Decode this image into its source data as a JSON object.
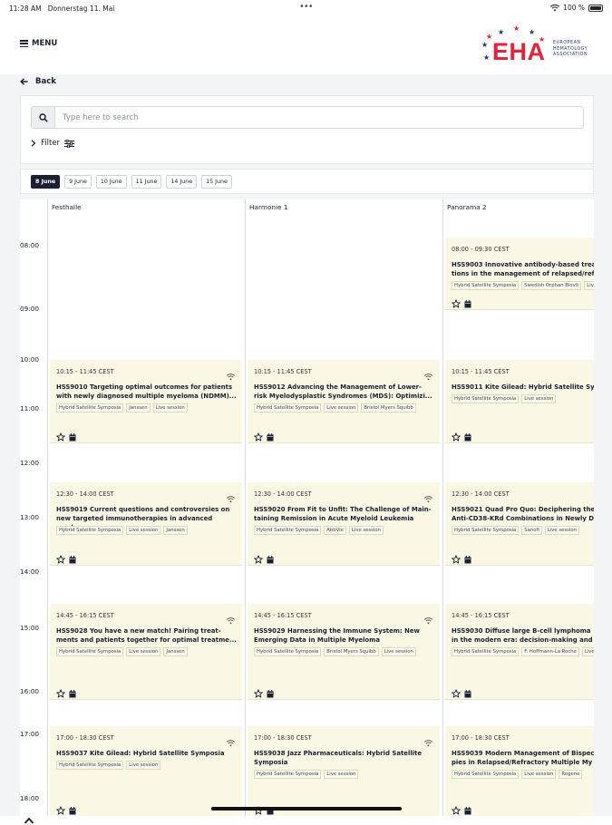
{
  "status": {
    "time": "11:28 AM",
    "date": "Donnerstag 11. Mai",
    "battery": "100 %"
  },
  "header": {
    "menu_label": "MENU",
    "logo_text": "EHA",
    "logo_sub": [
      "EUROPEAN",
      "HEMATOLOGY",
      "ASSOCIATION"
    ]
  },
  "back_label": "Back",
  "search": {
    "placeholder": "Type here to search"
  },
  "filter_label": "Filter",
  "dates": [
    "8 June",
    "9 June",
    "10 June",
    "11 June",
    "14 June",
    "15 June"
  ],
  "active_date": "8 June",
  "rooms": [
    "Festhalle",
    "Harmonie 1",
    "Panorama 2"
  ],
  "hours": [
    "08:00",
    "09:00",
    "10:00",
    "11:00",
    "12:00",
    "13:00",
    "14:00",
    "15:00",
    "16:00",
    "17:00",
    "18:00"
  ],
  "events": [
    {
      "room": 2,
      "slot": 0,
      "time": "08:00 - 09:30 CEST",
      "wifi": false,
      "title": "HSS9003 Innovative antibody-based trea\ntions in the management of relapsed/ref",
      "tags": [
        "Hybrid Satellite Symposia",
        "Swedish Orphan Biovit",
        "Live session"
      ]
    },
    {
      "room": 0,
      "slot": 1,
      "time": "10:15 - 11:45 CEST",
      "wifi": true,
      "title": "HSS9010 Targeting optimal outcomes for patients\nwith newly diagnosed multiple myeloma (NDMM)...",
      "tags": [
        "Hybrid Satellite Symposia",
        "Janssen",
        "Live session"
      ]
    },
    {
      "room": 1,
      "slot": 1,
      "time": "10:15 - 11:45 CEST",
      "wifi": true,
      "title": "HSS9012 Advancing the Management of Lower-\nrisk Myelodysplastic Syndromes (MDS): Optimizi...",
      "tags": [
        "Hybrid Satellite Symposia",
        "Live session",
        "Bristol Myers Squibb"
      ]
    },
    {
      "room": 2,
      "slot": 1,
      "time": "10:15 - 11:45 CEST",
      "wifi": false,
      "title": "HSS9011 Kite Gilead: Hybrid Satellite Sy",
      "tags": [
        "Hybrid Satellite Symposia",
        "Live session"
      ]
    },
    {
      "room": 0,
      "slot": 2,
      "time": "12:30 - 14:00 CEST",
      "wifi": true,
      "title": "HSS9019 Current questions and controversies on\nnew targeted immunotherapies in advanced myel...",
      "tags": [
        "Hybrid Satellite Symposia",
        "Live session",
        "Janssen"
      ]
    },
    {
      "room": 1,
      "slot": 2,
      "time": "12:30 - 14:00 CEST",
      "wifi": true,
      "title": "HSS9020 From Fit to Unfit: The Challenge of Main-\ntaining Remission in Acute Myeloid Leukemia",
      "tags": [
        "Hybrid Satellite Symposia",
        "AbbVie",
        "Live session"
      ]
    },
    {
      "room": 2,
      "slot": 2,
      "time": "12:30 - 14:00 CEST",
      "wifi": false,
      "title": "HSS9021 Quad Pro Quo: Deciphering the\nAnti-CD38-KRd Combinations in Newly D",
      "tags": [
        "Hybrid Satellite Symposia",
        "Sanofi",
        "Live session"
      ]
    },
    {
      "room": 0,
      "slot": 3,
      "time": "14:45 - 16:15 CEST",
      "wifi": true,
      "title": "HSS9028 You have a new match! Pairing treat-\nments and patients together for optimal treatme...",
      "tags": [
        "Hybrid Satellite Symposia",
        "Live session",
        "Janssen"
      ]
    },
    {
      "room": 1,
      "slot": 3,
      "time": "14:45 - 16:15 CEST",
      "wifi": true,
      "title": "HSS9029 Harnessing the Immune System: New\nEmerging Data in Multiple Myeloma",
      "tags": [
        "Hybrid Satellite Symposia",
        "Bristol Myers Squibb",
        "Live session"
      ]
    },
    {
      "room": 2,
      "slot": 3,
      "time": "14:45 - 16:15 CEST",
      "wifi": false,
      "title": "HSS9030 Diffuse large B-cell lymphoma\nin the modern era: decision-making and",
      "tags": [
        "Hybrid Satellite Symposia",
        "F. Hoffmann-La Roche",
        "Live session"
      ]
    },
    {
      "room": 0,
      "slot": 4,
      "time": "17:00 - 18:30 CEST",
      "wifi": true,
      "title": "HSS9037 Kite Gilead: Hybrid Satellite Symposia",
      "tags": [
        "Hybrid Satellite Symposia",
        "Live session"
      ]
    },
    {
      "room": 1,
      "slot": 4,
      "time": "17:00 - 18:30 CEST",
      "wifi": true,
      "title": "HSS9038 Jazz Pharmaceuticals: Hybrid Satellite\nSymposia",
      "tags": [
        "Hybrid Satellite Symposia",
        "Live session"
      ]
    },
    {
      "room": 2,
      "slot": 4,
      "time": "17:00 - 18:30 CEST",
      "wifi": false,
      "title": "HSS9039 Modern Management of Bispec\npies in Relapsed/Refractory Multiple My",
      "tags": [
        "Hybrid Satellite Symposia",
        "Live session",
        "Regene"
      ]
    }
  ],
  "colors": {
    "navy": "#1a1f33",
    "red": "#e2233a",
    "card": "#faf8e4"
  }
}
